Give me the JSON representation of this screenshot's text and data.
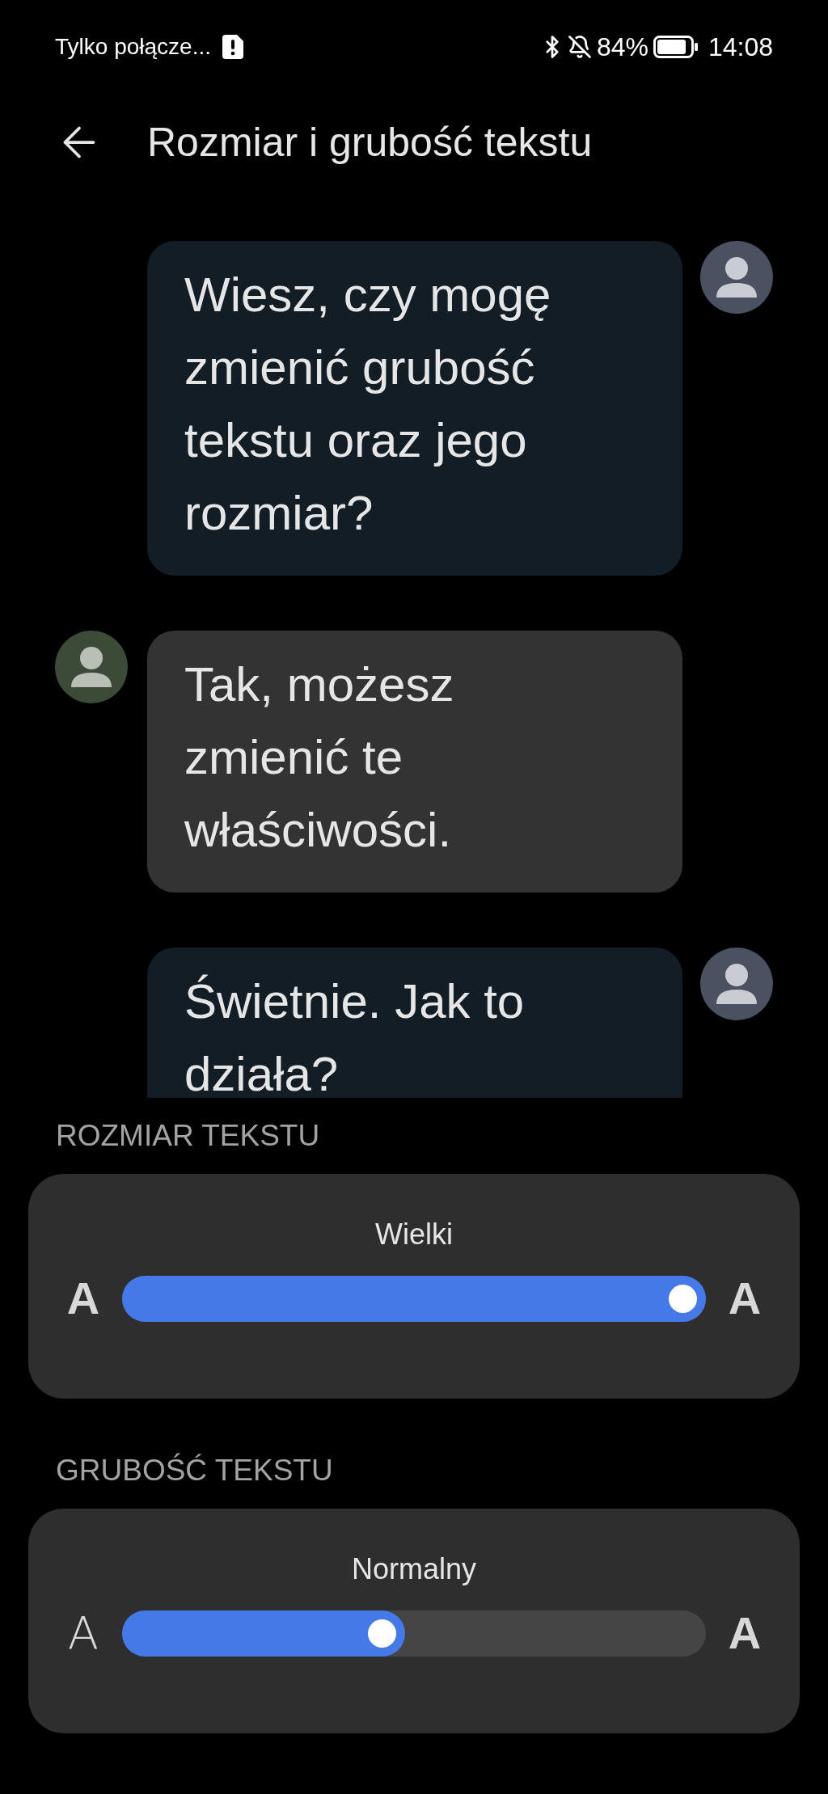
{
  "status_bar": {
    "carrier": "Tylko połącze...",
    "battery": "84%",
    "time": "14:08"
  },
  "header": {
    "title": "Rozmiar i grubość tekstu"
  },
  "messages": [
    {
      "kind": "outgoing",
      "text": "Wiesz, czy mogę zmienić grubość tekstu oraz jego rozmiar?"
    },
    {
      "kind": "incoming",
      "text": "Tak, możesz zmienić te właściwości."
    },
    {
      "kind": "outgoing",
      "text": "Świetnie. Jak to działa?"
    }
  ],
  "settings": [
    {
      "kind": "size",
      "heading": "ROZMIAR TEKSTU",
      "value": "Wielki",
      "level": 1.0,
      "min_label": "A",
      "max_label": "A"
    },
    {
      "kind": "weight",
      "heading": "GRUBOŚĆ TEKSTU",
      "value": "Normalny",
      "level": 0.44,
      "min_label": "A",
      "max_label": "A"
    }
  ]
}
